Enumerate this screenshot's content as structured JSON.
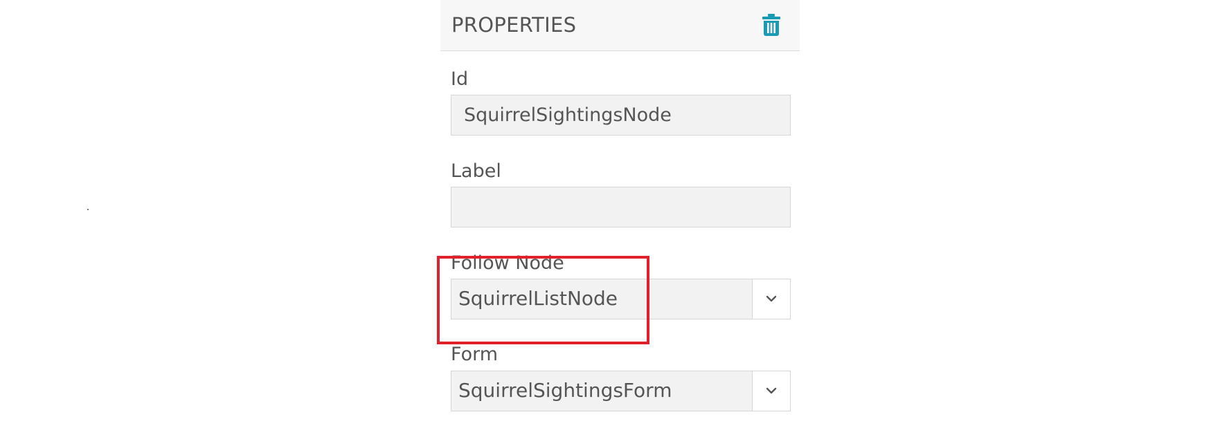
{
  "panel": {
    "title": "PROPERTIES",
    "delete_icon": "trash-icon",
    "accent_color": "#1a9ab5"
  },
  "fields": {
    "id": {
      "label": "Id",
      "value": "SquirrelSightingsNode"
    },
    "label": {
      "label": "Label",
      "value": ""
    },
    "follow_node": {
      "label": "Follow Node",
      "selected": "SquirrelListNode",
      "arrow_icon": "chevron-down-icon"
    },
    "form": {
      "label": "Form",
      "selected": "SquirrelSightingsForm",
      "arrow_icon": "chevron-down-icon"
    }
  },
  "annotation": {
    "highlight_color": "#e0202b"
  }
}
